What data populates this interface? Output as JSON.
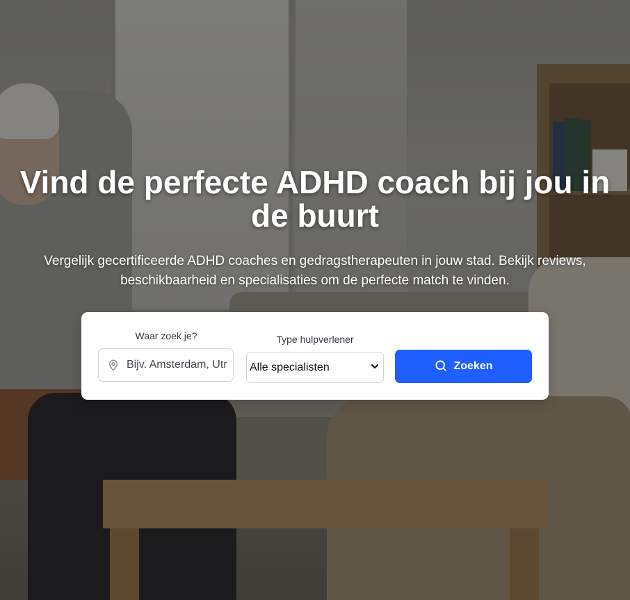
{
  "hero": {
    "title": "Vind de perfecte ADHD coach bij jou in de buurt",
    "subtitle": "Vergelijk gecertificeerde ADHD coaches en gedragstherapeuten in jouw stad. Bekijk reviews, beschikbaarheid en specialisaties om de perfecte match te vinden."
  },
  "search": {
    "location_label": "Waar zoek je?",
    "location_placeholder": "Bijv. Amsterdam, Utrecht...",
    "location_value": "",
    "location_icon": "map-pin-icon",
    "type_label": "Type hulpverlener",
    "type_selected": "Alle specialisten",
    "type_icon": "chevron-down-icon",
    "button_label": "Zoeken",
    "button_icon": "search-icon"
  },
  "colors": {
    "accent": "#1f5fff",
    "title_text": "#ffffff",
    "card_background": "#ffffff"
  }
}
